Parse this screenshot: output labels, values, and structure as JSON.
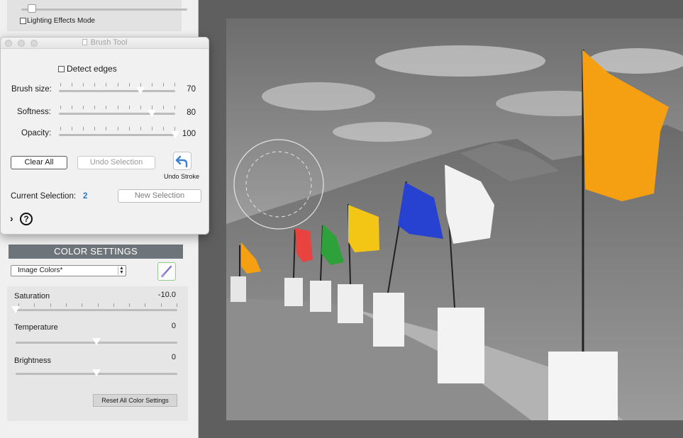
{
  "sidebar": {
    "lighting_effects_label": "Lighting Effects Mode"
  },
  "brush_tool": {
    "window_title": "Brush Tool",
    "detect_edges_label": "Detect edges",
    "sliders": [
      {
        "label": "Brush size:",
        "value": "70",
        "level": 0.7
      },
      {
        "label": "Softness:",
        "value": "80",
        "level": 0.8
      },
      {
        "label": "Opacity:",
        "value": "100",
        "level": 1.0
      }
    ],
    "clear_all_label": "Clear All",
    "undo_selection_label": "Undo Selection",
    "undo_stroke_label": "Undo Stroke",
    "current_selection_label": "Current Selection:",
    "current_selection_value": "2",
    "new_selection_label": "New Selection",
    "expand_icon": "chevron-right-icon",
    "help_icon": "help-circle-icon",
    "help_glyph": "?"
  },
  "color_settings": {
    "header": "COLOR SETTINGS",
    "preset_value": "Image Colors*",
    "saturation": {
      "label": "Saturation",
      "value": "-10.0",
      "level": 0.0
    },
    "temperature": {
      "label": "Temperature",
      "value": "0",
      "level": 0.5
    },
    "brightness": {
      "label": "Brightness",
      "value": "0",
      "level": 0.5
    },
    "reset_label": "Reset All Color Settings"
  },
  "colors": {
    "accent_blue": "#2a74c9",
    "flag_orange": "#f5a013",
    "flag_red": "#e8433e",
    "flag_green": "#2fa13b",
    "flag_yellow": "#f3c515",
    "flag_blue": "#2741d0",
    "header_gray": "#6d747a"
  }
}
